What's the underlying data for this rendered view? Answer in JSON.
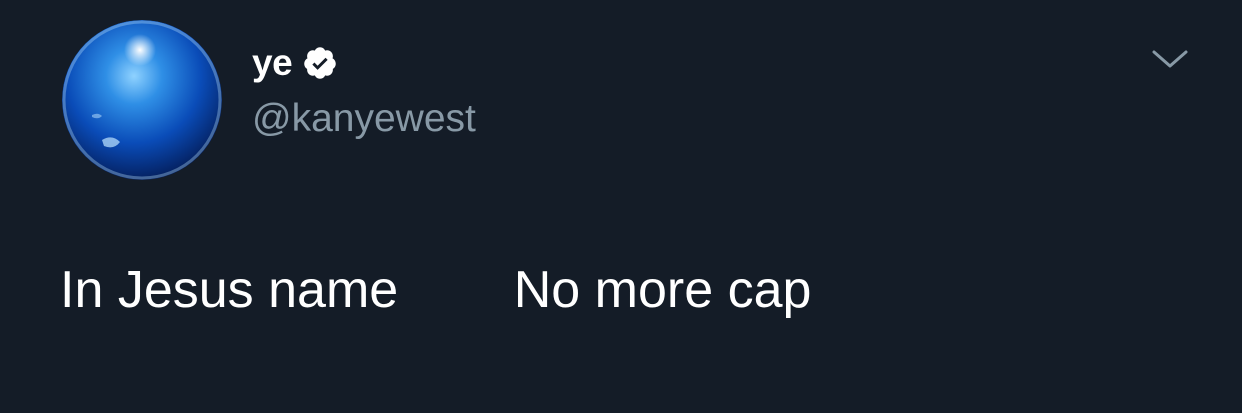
{
  "tweet": {
    "author": {
      "display_name": "ye",
      "handle": "@kanyewest",
      "verified": true,
      "verified_icon": "verified-badge-icon",
      "avatar_icon": "blue-sphere-avatar"
    },
    "menu_icon": "chevron-down-icon",
    "text": "In Jesus name        No more cap"
  },
  "colors": {
    "background": "#141c27",
    "primary_text": "#ffffff",
    "secondary_text": "#8899a6"
  }
}
